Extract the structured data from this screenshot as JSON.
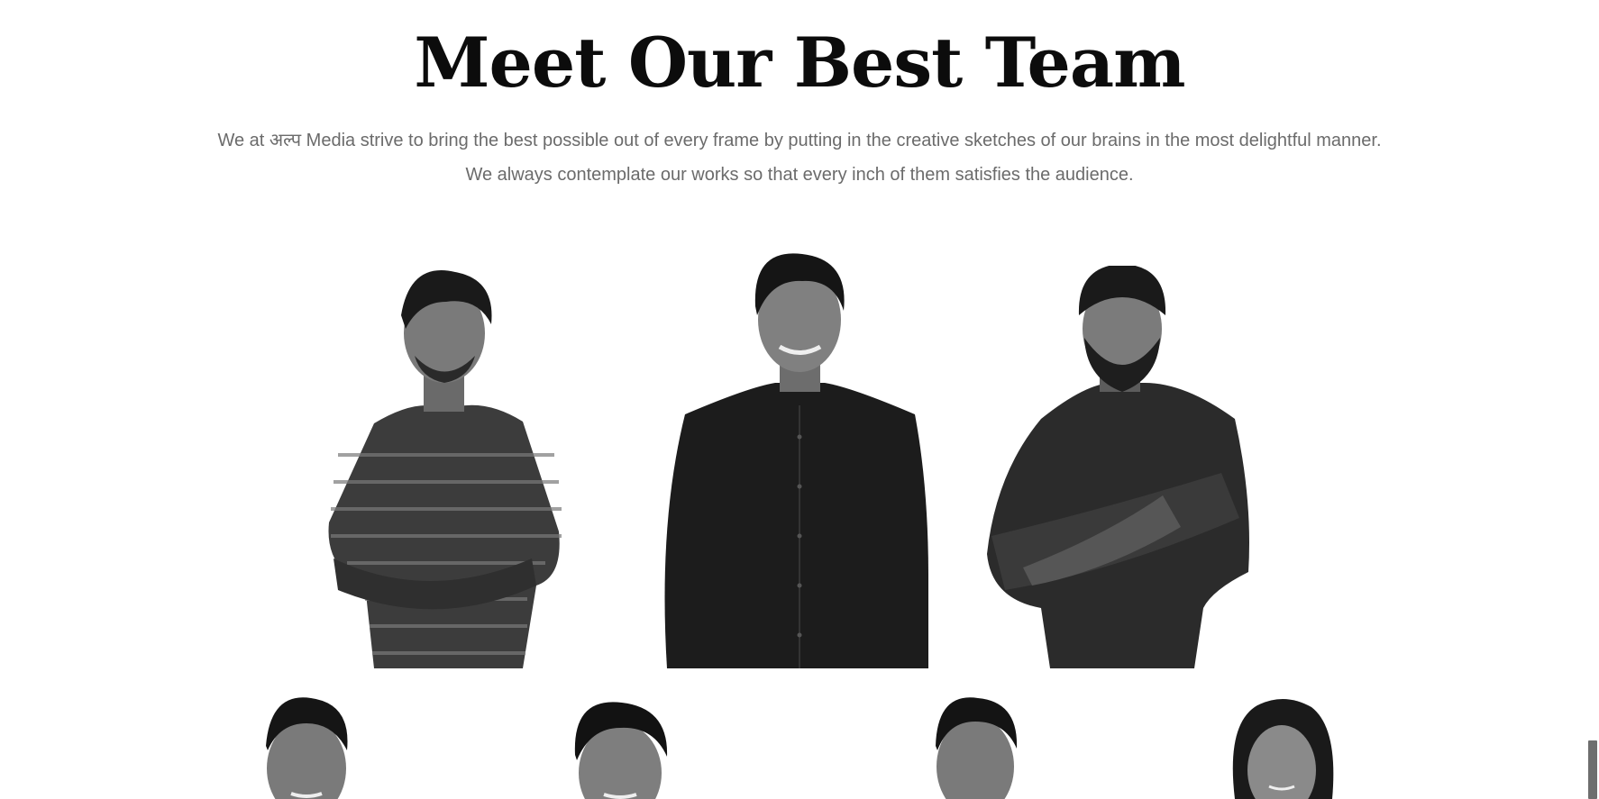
{
  "team_section": {
    "title": "Meet Our Best Team",
    "intro_line_1": "We at अल्प Media strive to bring the best possible out of every frame by putting in the creative sketches of our brains in the most delightful manner.",
    "intro_line_2": "We always contemplate our works so that every inch of them satisfies the audience."
  },
  "colors": {
    "title": "#0c0c0c",
    "body_text": "#6b6b6b",
    "background": "#ffffff"
  }
}
